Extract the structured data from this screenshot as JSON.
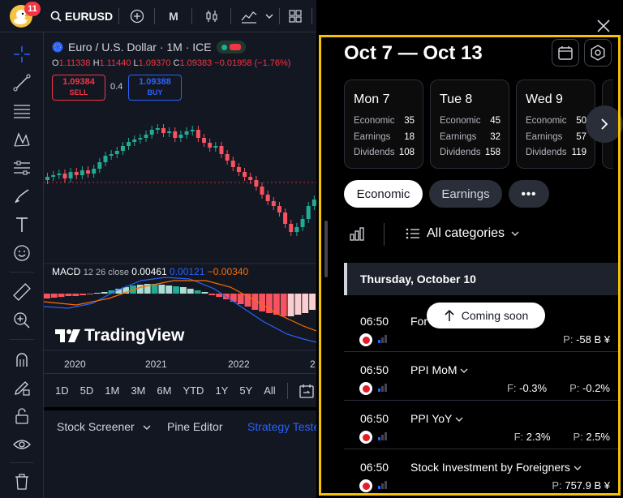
{
  "topbar": {
    "notification_count": "11",
    "symbol": "EURUSD",
    "interval": "M"
  },
  "chart": {
    "title": "Euro / U.S. Dollar · 1M · ICE",
    "ohlc": {
      "o_label": "O",
      "o": "1.11338",
      "h_label": "H",
      "h": "1.11440",
      "l_label": "L",
      "l": "1.09370",
      "c_label": "C",
      "c": "1.09383",
      "change": "−0.01958 (−1.76%)"
    },
    "sell": {
      "price": "1.09384",
      "label": "SELL"
    },
    "spread": "0.4",
    "buy": {
      "price": "1.09388",
      "label": "BUY"
    },
    "macd": {
      "label": "MACD",
      "params": "12 26 close",
      "v1": "0.00461",
      "v2": "0.00121",
      "v3": "−0.00340"
    },
    "watermark": "TradingView",
    "x_labels": [
      "2020",
      "2021",
      "2022",
      "2"
    ],
    "colors": {
      "up": "#22ab94",
      "down": "#f7525f",
      "macd": "#2962ff",
      "signal": "#ff6d00"
    }
  },
  "ranges": [
    "1D",
    "5D",
    "1M",
    "3M",
    "6M",
    "YTD",
    "1Y",
    "5Y",
    "All"
  ],
  "bottom_tabs": [
    "Stock Screener",
    "Pine Editor",
    "Strategy Tester"
  ],
  "calendar": {
    "date_range": "Oct 7 — Oct 13",
    "days": [
      {
        "title": "Mon 7",
        "economic": "35",
        "earnings": "18",
        "dividends": "108"
      },
      {
        "title": "Tue 8",
        "economic": "45",
        "earnings": "32",
        "dividends": "158"
      },
      {
        "title": "Wed 9",
        "economic": "50",
        "earnings": "57",
        "dividends": "119"
      }
    ],
    "row_labels": {
      "economic": "Economic",
      "earnings": "Earnings",
      "dividends": "Dividends"
    },
    "filters": {
      "economic": "Economic",
      "earnings": "Earnings",
      "more": "•••"
    },
    "category": "All categories",
    "day_header": "Thursday, October 10",
    "toast": "Coming soon",
    "events": [
      {
        "time": "06:50",
        "name": "For",
        "forecast": "",
        "prior": "-58 B ¥"
      },
      {
        "time": "06:50",
        "name": "PPI MoM",
        "forecast": "-0.3%",
        "prior": "-0.2%"
      },
      {
        "time": "06:50",
        "name": "PPI YoY",
        "forecast": "2.3%",
        "prior": "2.5%"
      },
      {
        "time": "06:50",
        "name": "Stock Investment by Foreigners",
        "forecast": "",
        "prior": "757.9 B ¥"
      }
    ],
    "labels": {
      "forecast": "F:",
      "prior": "P:"
    },
    "accent": "#f7c300"
  }
}
